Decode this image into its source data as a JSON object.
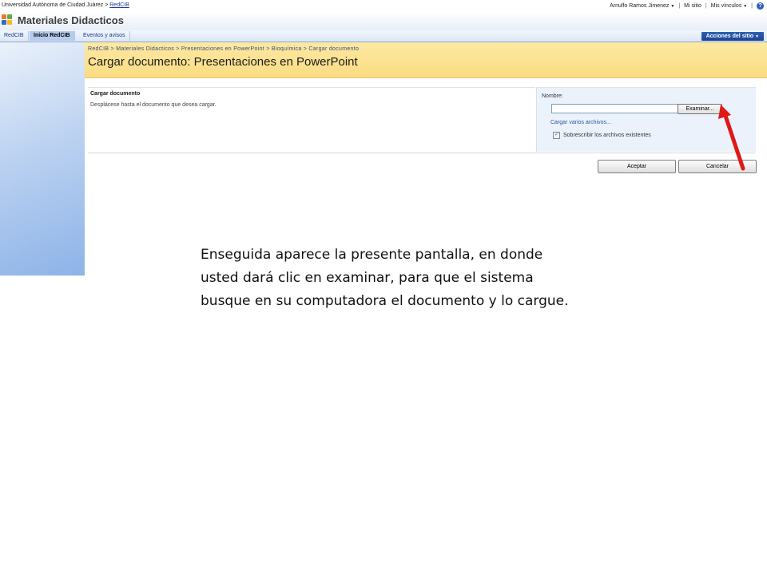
{
  "top": {
    "org": "Universidad Autónoma de Ciudad Juárez",
    "separator": ">",
    "site_link": "RedCIB",
    "user": "Arnulfo Ramos Jimenez",
    "my_site": "Mi sitio",
    "my_links": "Mis vínculos",
    "divider": "|",
    "help_glyph": "?"
  },
  "site_title": "Materiales Didacticos",
  "nav": {
    "tabs": [
      {
        "label": "RedCIB"
      },
      {
        "label": "Inicio RedCIB"
      },
      {
        "label": "Eventos y avisos"
      }
    ],
    "site_actions": "Acciones del sitio"
  },
  "page": {
    "breadcrumb": "RedCIB > Materiales Didacticos > Presentaciones en PowerPoint > Bioquímica > Cargar documento",
    "title": "Cargar documento: Presentaciones en PowerPoint"
  },
  "form": {
    "section_title": "Cargar documento",
    "section_desc": "Desplácese hasta el documento que desea cargar.",
    "name_label": "Nombre:",
    "file_value": "",
    "browse_label": "Examinar...",
    "multi_link": "Cargar varios archivos...",
    "overwrite_label": "Sobrescribir los archivos existentes",
    "overwrite_checked": true,
    "ok_label": "Aceptar",
    "cancel_label": "Cancelar"
  },
  "caption": "Enseguida aparece la presente pantalla, en donde usted dará clic en examinar, para que el sistema busque en su computadora el documento y lo cargue.",
  "colors": {
    "header_yellow": "#fbdc82",
    "nav_blue": "#1c4391",
    "arrow_red": "#e01818"
  }
}
